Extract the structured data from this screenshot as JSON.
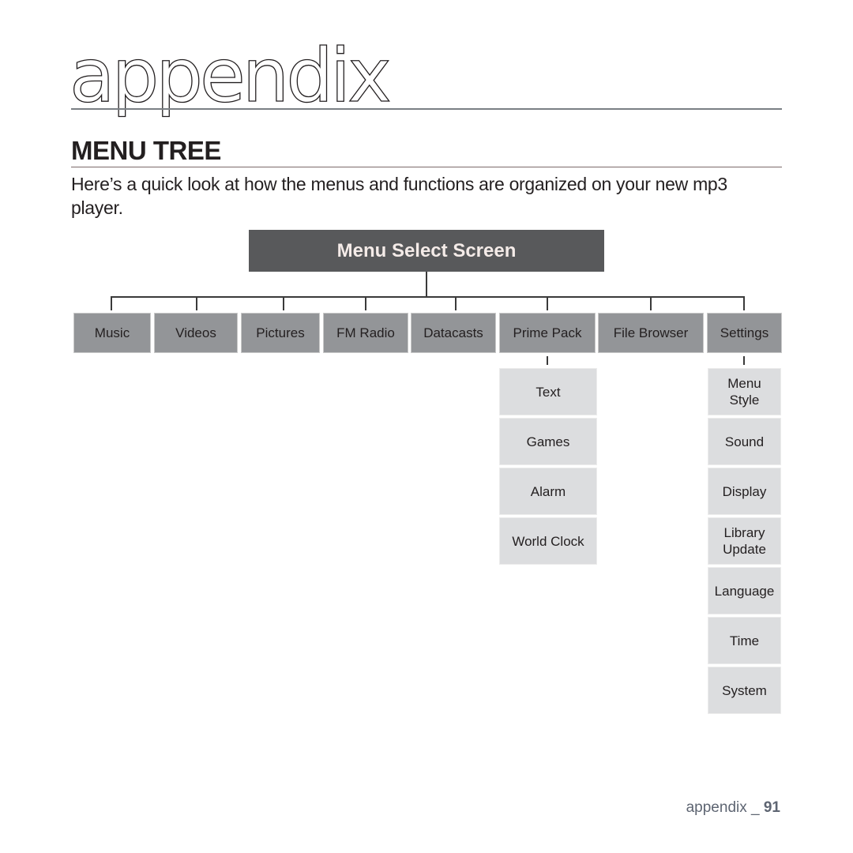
{
  "chapter": {
    "title": "appendix"
  },
  "section": {
    "title": "MENU TREE"
  },
  "intro": "Here’s a quick look at how the menus and functions are organized on your new mp3 player.",
  "tree": {
    "root": "Menu Select Screen",
    "top_items": [
      {
        "label": "Music"
      },
      {
        "label": "Videos"
      },
      {
        "label": "Pictures"
      },
      {
        "label": "FM Radio"
      },
      {
        "label": "Datacasts"
      },
      {
        "label": "Prime Pack"
      },
      {
        "label": "File Browser"
      },
      {
        "label": "Settings"
      }
    ],
    "prime_pack_children": [
      "Text",
      "Games",
      "Alarm",
      "World Clock"
    ],
    "settings_children": [
      "Menu\nStyle",
      "Sound",
      "Display",
      "Library\nUpdate",
      "Language",
      "Time",
      "System"
    ]
  },
  "footer": {
    "section": "appendix _ ",
    "page": "91"
  },
  "colors": {
    "root_bg": "#58595b",
    "top_bg": "#939598",
    "sub_bg": "#dcdddf",
    "footer_text": "#5e6572"
  }
}
